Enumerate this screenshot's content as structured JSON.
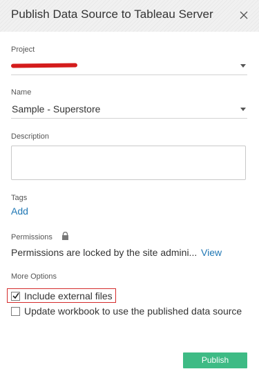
{
  "dialog": {
    "title": "Publish Data Source to Tableau Server"
  },
  "project": {
    "label": "Project",
    "value_redacted": true
  },
  "name": {
    "label": "Name",
    "value": "Sample - Superstore"
  },
  "description": {
    "label": "Description",
    "value": ""
  },
  "tags": {
    "label": "Tags",
    "add_link": "Add"
  },
  "permissions": {
    "label": "Permissions",
    "icon": "lock-icon",
    "text": "Permissions are locked by the site admini...",
    "view_link": "View"
  },
  "more_options": {
    "label": "More Options",
    "include_external_files": {
      "label": "Include external files",
      "checked": true
    },
    "update_workbook": {
      "label": "Update workbook to use the published data source",
      "checked": false
    }
  },
  "footer": {
    "publish_label": "Publish"
  },
  "colors": {
    "link": "#1f77b4",
    "publish_button": "#3ebb85",
    "highlight_border": "#d42a2a",
    "redaction": "#d41c1c"
  }
}
